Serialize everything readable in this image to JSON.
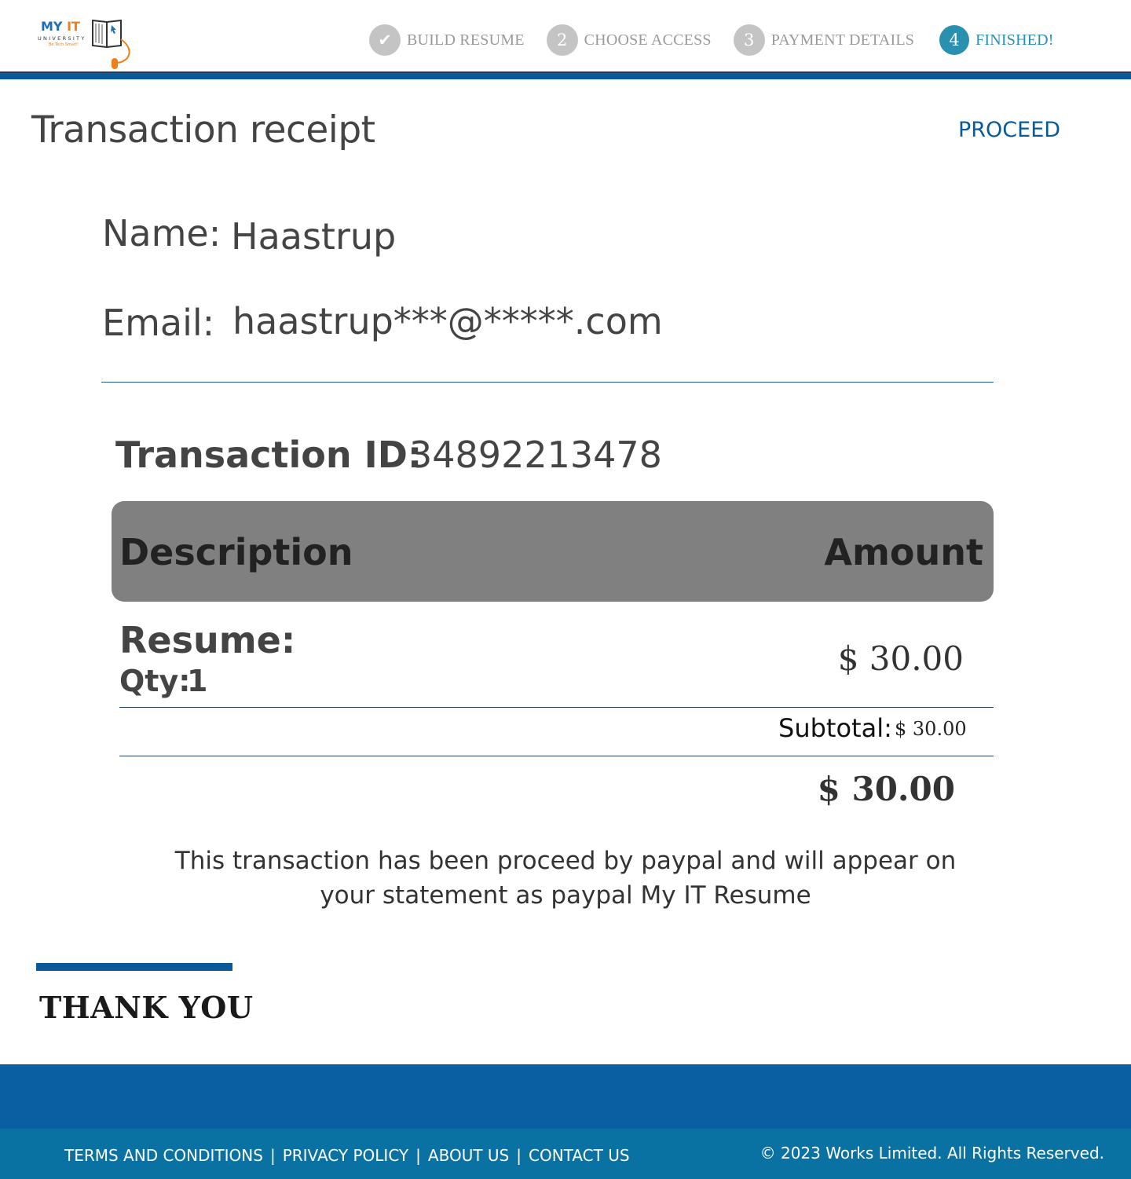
{
  "brand": {
    "logo_line1_a": "MY",
    "logo_line1_b": "IT",
    "logo_line2": "UNIVERSITY",
    "logo_tagline": "Be Tech Smart!",
    "colors": {
      "primary": "#0a5a99",
      "accent": "#f07f1a",
      "active_step": "#2a90b0"
    }
  },
  "steps": [
    {
      "marker": "✔",
      "label": "BUILD RESUME",
      "state": "done",
      "icon": "check-icon"
    },
    {
      "marker": "2",
      "label": "CHOOSE ACCESS",
      "state": "pending"
    },
    {
      "marker": "3",
      "label": "PAYMENT DETAILS",
      "state": "pending"
    },
    {
      "marker": "4",
      "label": "FINISHED!",
      "state": "active"
    }
  ],
  "page": {
    "title": "Transaction receipt",
    "proceed_label": "PROCEED"
  },
  "customer": {
    "name_label": "Name:",
    "name_value": "Haastrup",
    "email_label": "Email:",
    "email_value": "haastrup***@*****.com"
  },
  "transaction": {
    "id_label": "Transaction ID:",
    "id_value": "34892213478"
  },
  "table": {
    "headers": {
      "description": "Description",
      "amount": "Amount"
    },
    "items": [
      {
        "name": "Resume:",
        "qty_label": "Qty:",
        "qty_value": "1",
        "amount": "$ 30.00"
      }
    ],
    "subtotal_label": "Subtotal:",
    "subtotal_value": "$ 30.00",
    "total_value": "$ 30.00"
  },
  "note": "This transaction has been proceed by paypal and will appear on your statement as paypal My IT Resume",
  "thanks": "THANK YOU",
  "footer": {
    "links": [
      "TERMS AND CONDITIONS",
      "PRIVACY POLICY",
      "ABOUT US",
      "CONTACT US"
    ],
    "separator": "|",
    "copyright": "© 2023 Works Limited. All Rights Reserved."
  }
}
